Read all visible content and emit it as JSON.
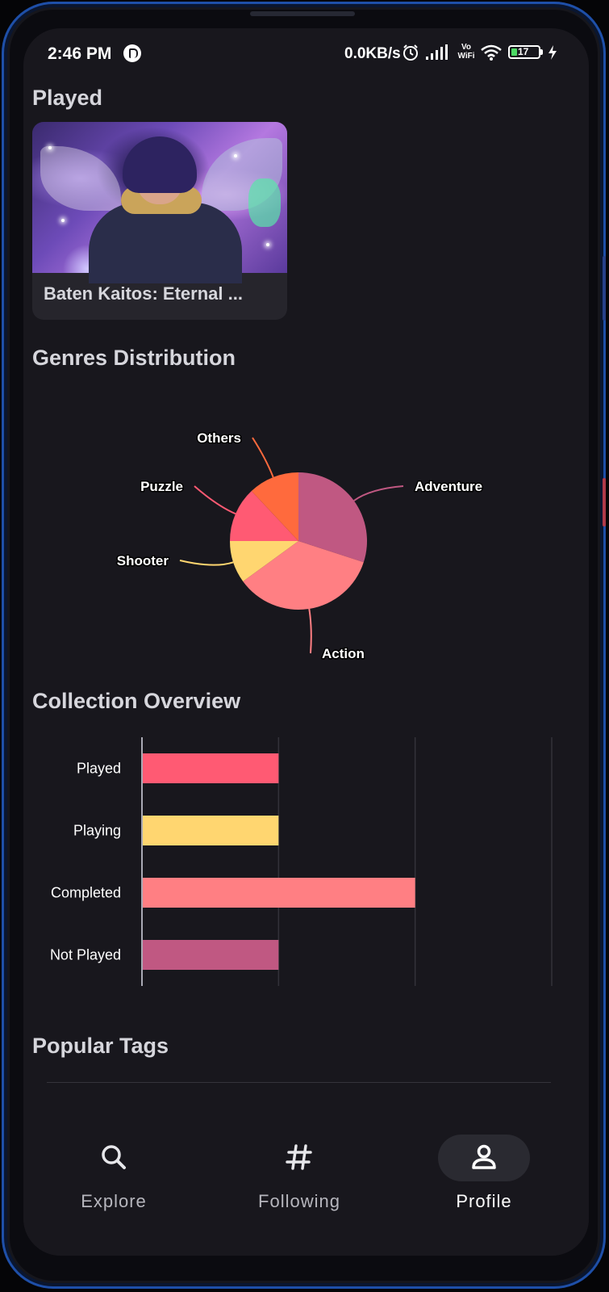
{
  "status_bar": {
    "time": "2:46 PM",
    "network_speed": "0.0KB/s",
    "volte_top": "Vo",
    "volte_bottom": "WiFi",
    "battery_level": "17",
    "icons": [
      "app-notification-icon",
      "alarm-icon",
      "signal-icon",
      "wifi-icon",
      "battery-icon",
      "charging-icon"
    ]
  },
  "played": {
    "title": "Played",
    "games": [
      {
        "title": "Baten Kaitos: Eternal ..."
      }
    ]
  },
  "genres": {
    "title": "Genres Distribution"
  },
  "collection": {
    "title": "Collection Overview"
  },
  "popular_tags": {
    "title": "Popular Tags"
  },
  "nav": {
    "items": [
      {
        "label": "Explore",
        "icon": "search-icon",
        "active": false
      },
      {
        "label": "Following",
        "icon": "hash-icon",
        "active": false
      },
      {
        "label": "Profile",
        "icon": "person-icon",
        "active": true
      }
    ]
  },
  "colors": {
    "background": "#18171d",
    "adventure": "#c05882",
    "action": "#ff7f83",
    "shooter": "#ffd670",
    "puzzle": "#ff5a73",
    "others": "#ff6a3d",
    "played": "#ff5a73",
    "playing": "#ffd670",
    "completed": "#ff7f83",
    "not_played": "#c05882"
  },
  "chart_data": [
    {
      "type": "pie",
      "title": "Genres Distribution",
      "labels": [
        "Adventure",
        "Action",
        "Shooter",
        "Puzzle",
        "Others"
      ],
      "values": [
        30,
        35,
        10,
        13,
        12
      ],
      "colors": [
        "#c05882",
        "#ff7f83",
        "#ffd670",
        "#ff5a73",
        "#ff6a3d"
      ]
    },
    {
      "type": "bar",
      "orientation": "horizontal",
      "title": "Collection Overview",
      "categories": [
        "Played",
        "Playing",
        "Completed",
        "Not Played"
      ],
      "values": [
        1,
        1,
        2,
        1
      ],
      "xlim": [
        0,
        3
      ],
      "colors": [
        "#ff5a73",
        "#ffd670",
        "#ff7f83",
        "#c05882"
      ],
      "grid": true
    }
  ]
}
